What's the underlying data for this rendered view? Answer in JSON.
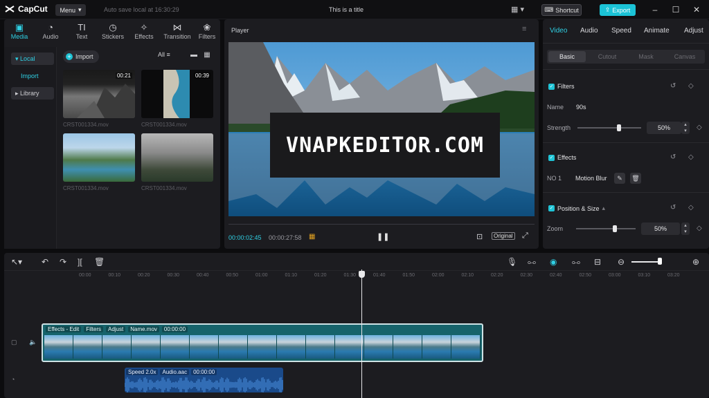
{
  "app": {
    "name": "CapCut",
    "menu_label": "Menu",
    "autosave": "Auto save local at 16:30:29",
    "title": "This is a title",
    "shortcut_label": "Shortcut",
    "export_label": "Export"
  },
  "media_panel": {
    "tabs": [
      {
        "label": "Media",
        "icon": "media-icon"
      },
      {
        "label": "Audio",
        "icon": "audio-icon"
      },
      {
        "label": "Text",
        "icon": "text-icon"
      },
      {
        "label": "Stickers",
        "icon": "sticker-icon"
      },
      {
        "label": "Effects",
        "icon": "effects-icon"
      },
      {
        "label": "Transition",
        "icon": "transition-icon"
      },
      {
        "label": "Filters",
        "icon": "filters-icon"
      }
    ],
    "sidebar": [
      {
        "label": "Local"
      },
      {
        "label": "Import"
      },
      {
        "label": "Library"
      }
    ],
    "import_label": "Import",
    "filter_label": "All",
    "clips": [
      {
        "name": "CRST001334.mov",
        "duration": "00:21"
      },
      {
        "name": "CRST001334.mov",
        "duration": "00:39"
      },
      {
        "name": "CRST001334.mov",
        "duration": ""
      },
      {
        "name": "CRST001334.mov",
        "duration": ""
      }
    ]
  },
  "player": {
    "title": "Player",
    "overlay_text": "VNAPKEDITOR.COM",
    "current_time": "00:00:02:45",
    "total_time": "00:00:27:58",
    "original_label": "Original"
  },
  "inspector": {
    "tabs": [
      "Video",
      "Audio",
      "Speed",
      "Animate",
      "Adjust"
    ],
    "subtabs": [
      "Basic",
      "Cutout",
      "Mask",
      "Canvas"
    ],
    "filters": {
      "title": "Filters",
      "name_label": "Name",
      "name_value": "90s",
      "strength_label": "Strength",
      "strength_value": "50%",
      "strength_level": 0.5
    },
    "effects": {
      "title": "Effects",
      "slot_label": "NO 1",
      "effect_name": "Motion Blur"
    },
    "position": {
      "title": "Position & Size",
      "zoom_label": "Zoom",
      "zoom_value": "50%",
      "zoom_level": 0.5
    }
  },
  "timeline": {
    "ruler_ticks": [
      "00:00",
      "00:10",
      "00:20",
      "00:30",
      "00:40",
      "00:50",
      "01:00",
      "01:10",
      "01:20",
      "01:30",
      "01:40",
      "01:50",
      "02:00",
      "02:10",
      "02:20",
      "02:30",
      "02:40",
      "02:50",
      "03:00",
      "03:10",
      "03:20"
    ],
    "video_track_tags": [
      "Effects - Edit",
      "Filters",
      "Adjust",
      "Name.mov",
      "00:00:00"
    ],
    "audio_track_tags": [
      "Speed 2.0x",
      "Audio.aac",
      "00:00:00"
    ]
  },
  "colors": {
    "accent": "#1fc4d6",
    "panel": "#1c1c20",
    "background": "#0c0c0e"
  }
}
